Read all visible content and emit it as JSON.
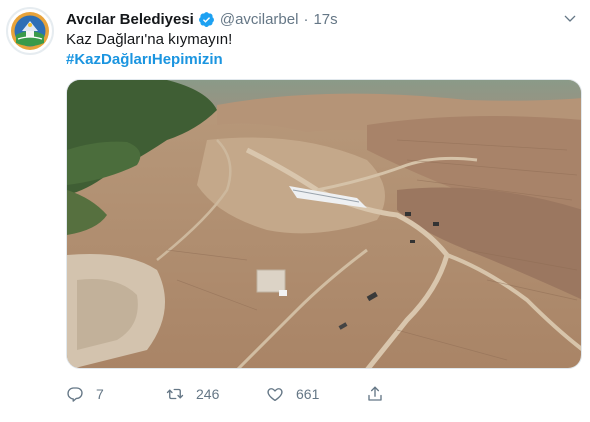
{
  "tweet": {
    "author_name": "Avcılar Belediyesi",
    "handle": "@avcilarbel",
    "separator": "·",
    "time": "17s",
    "text": "Kaz Dağları'na kıymayın!",
    "hashtag": "#KazDağlarıHepimizin",
    "verified_icon": "verified-badge-icon",
    "menu_icon": "chevron-down-icon"
  },
  "actions": {
    "reply_count": "7",
    "retweet_count": "246",
    "like_count": "661"
  },
  "colors": {
    "link": "#1b95e0",
    "muted": "#657786",
    "verified": "#1da1f2"
  }
}
